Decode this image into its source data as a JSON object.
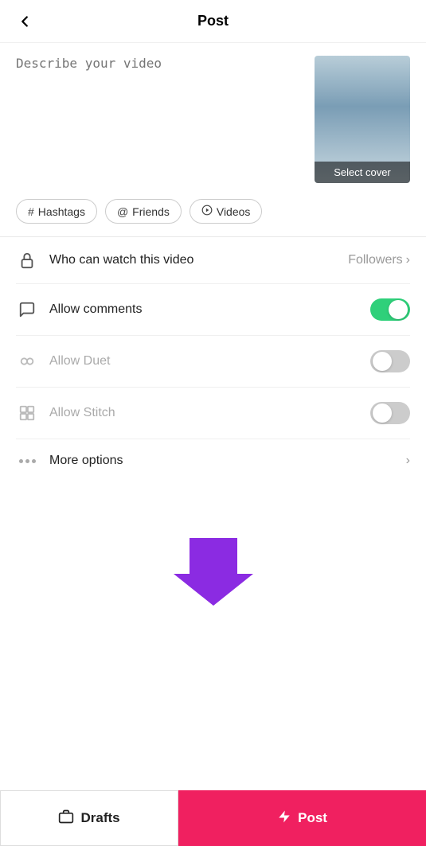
{
  "header": {
    "back_label": "←",
    "title": "Post"
  },
  "description": {
    "placeholder": "Describe your video"
  },
  "video": {
    "select_cover_label": "Select cover"
  },
  "tags": [
    {
      "id": "hashtags",
      "icon": "#",
      "label": "Hashtags"
    },
    {
      "id": "friends",
      "icon": "@",
      "label": "Friends"
    },
    {
      "id": "videos",
      "icon": "▷",
      "label": "Videos"
    }
  ],
  "settings": [
    {
      "id": "who-can-watch",
      "label": "Who can watch this video",
      "value": "Followers",
      "type": "chevron",
      "icon": "lock",
      "muted": false
    },
    {
      "id": "allow-comments",
      "label": "Allow comments",
      "value": "",
      "type": "toggle",
      "toggle_on": true,
      "icon": "comment",
      "muted": false
    },
    {
      "id": "allow-duet",
      "label": "Allow Duet",
      "value": "",
      "type": "toggle",
      "toggle_on": false,
      "icon": "duet",
      "muted": true
    },
    {
      "id": "allow-stitch",
      "label": "Allow Stitch",
      "value": "",
      "type": "toggle",
      "toggle_on": false,
      "icon": "stitch",
      "muted": true
    },
    {
      "id": "more-options",
      "label": "More options",
      "value": "",
      "type": "chevron",
      "icon": "dots",
      "muted": false
    }
  ],
  "bottom": {
    "drafts_label": "Drafts",
    "post_label": "Post"
  }
}
